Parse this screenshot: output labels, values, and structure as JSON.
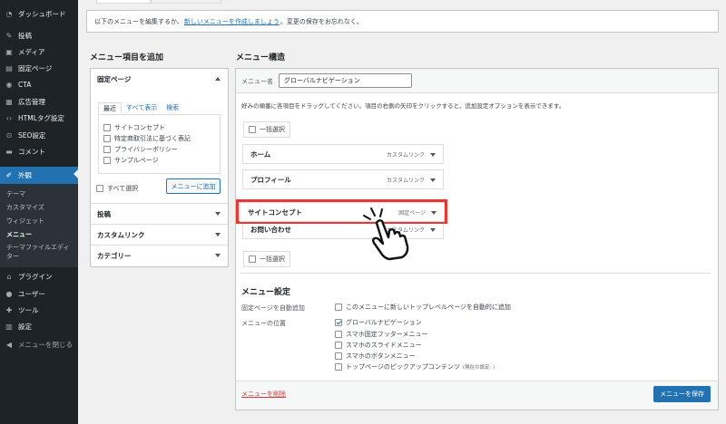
{
  "sidebar": {
    "items": [
      {
        "label": "ダッシュボード",
        "icon": "dashboard-icon",
        "glyph": "◔"
      },
      {
        "label": "投稿",
        "icon": "pin-icon",
        "glyph": "✎"
      },
      {
        "label": "メディア",
        "icon": "media-icon",
        "glyph": "▣"
      },
      {
        "label": "固定ページ",
        "icon": "page-icon",
        "glyph": "▤"
      },
      {
        "label": "CTA",
        "icon": "megaphone-icon",
        "glyph": "◉"
      },
      {
        "label": "広告管理",
        "icon": "ad-icon",
        "glyph": "▦"
      },
      {
        "label": "HTMLタグ設定",
        "icon": "code-icon",
        "glyph": "‹›"
      },
      {
        "label": "SEO設定",
        "icon": "seo-icon",
        "glyph": "⊙"
      },
      {
        "label": "コメント",
        "icon": "comment-icon",
        "glyph": "▬"
      },
      {
        "label": "外観",
        "icon": "appearance-icon",
        "glyph": "✐"
      },
      {
        "label": "プラグイン",
        "icon": "plugin-icon",
        "glyph": "⌂"
      },
      {
        "label": "ユーザー",
        "icon": "user-icon",
        "glyph": "●"
      },
      {
        "label": "ツール",
        "icon": "wrench-icon",
        "glyph": "✚"
      },
      {
        "label": "設定",
        "icon": "settings-icon",
        "glyph": "▥"
      },
      {
        "label": "メニューを閉じる",
        "icon": "collapse-icon",
        "glyph": "◀"
      }
    ],
    "submenu": [
      "テーマ",
      "カスタマイズ",
      "ウィジェット",
      "メニュー",
      "テーマファイルエディ",
      "ター"
    ]
  },
  "notice": {
    "before": "以下のメニューを編集するか、",
    "link": "新しいメニューを作成しましょう",
    "after": "。変更の保存をお忘れなく。"
  },
  "left": {
    "heading": "メニュー項目を追加",
    "pages_title": "固定ページ",
    "tabs": [
      "最近",
      "すべて表示",
      "検索"
    ],
    "pages": [
      {
        "label": "サイトコンセプト",
        "checked": false
      },
      {
        "label": "特定商取引法に基づく表記",
        "checked": false
      },
      {
        "label": "プライバシーポリシー",
        "checked": false
      },
      {
        "label": "サンプルページ",
        "checked": false
      }
    ],
    "select_all": "すべて選択",
    "add_button": "メニューに追加",
    "sections": [
      "投稿",
      "カスタムリンク",
      "カテゴリー"
    ]
  },
  "right": {
    "heading": "メニュー構造",
    "name_label": "メニュー名",
    "name_value": "グローバルナビゲーション",
    "instructions": "好みの順番に各項目をドラッグしてください。項目の右側の矢印をクリックすると、追加設定オプションを表示できます。",
    "bulk_select": "一括選択",
    "items": [
      {
        "title": "ホーム",
        "type": "カスタムリンク"
      },
      {
        "title": "プロフィール",
        "type": "カスタムリンク"
      },
      {
        "title": "サイトコンセプト",
        "type": "固定ページ"
      },
      {
        "title": "お問い合わせ",
        "type": "カスタムリンク"
      }
    ],
    "settings_heading": "メニュー設定",
    "auto_add_label": "固定ページを自動追加",
    "auto_add_option": "このメニューに新しいトップレベルページを自動的に追加",
    "location_label": "メニューの位置",
    "locations": [
      {
        "label": "グローバルナビゲーション",
        "checked": true,
        "note": ""
      },
      {
        "label": "スマホ固定フッターメニュー",
        "checked": false,
        "note": ""
      },
      {
        "label": "スマホのスライドメニュー",
        "checked": false,
        "note": ""
      },
      {
        "label": "スマホのボタンメニュー",
        "checked": false,
        "note": ""
      },
      {
        "label": "トップページのピックアップコンテンツ",
        "checked": false,
        "note": "(現在の設定: )"
      }
    ],
    "delete_link": "メニューを削除",
    "save_button": "メニューを保存"
  },
  "colors": {
    "accent": "#2271b1",
    "highlight": "#e53935",
    "sidebar": "#1d2327"
  }
}
